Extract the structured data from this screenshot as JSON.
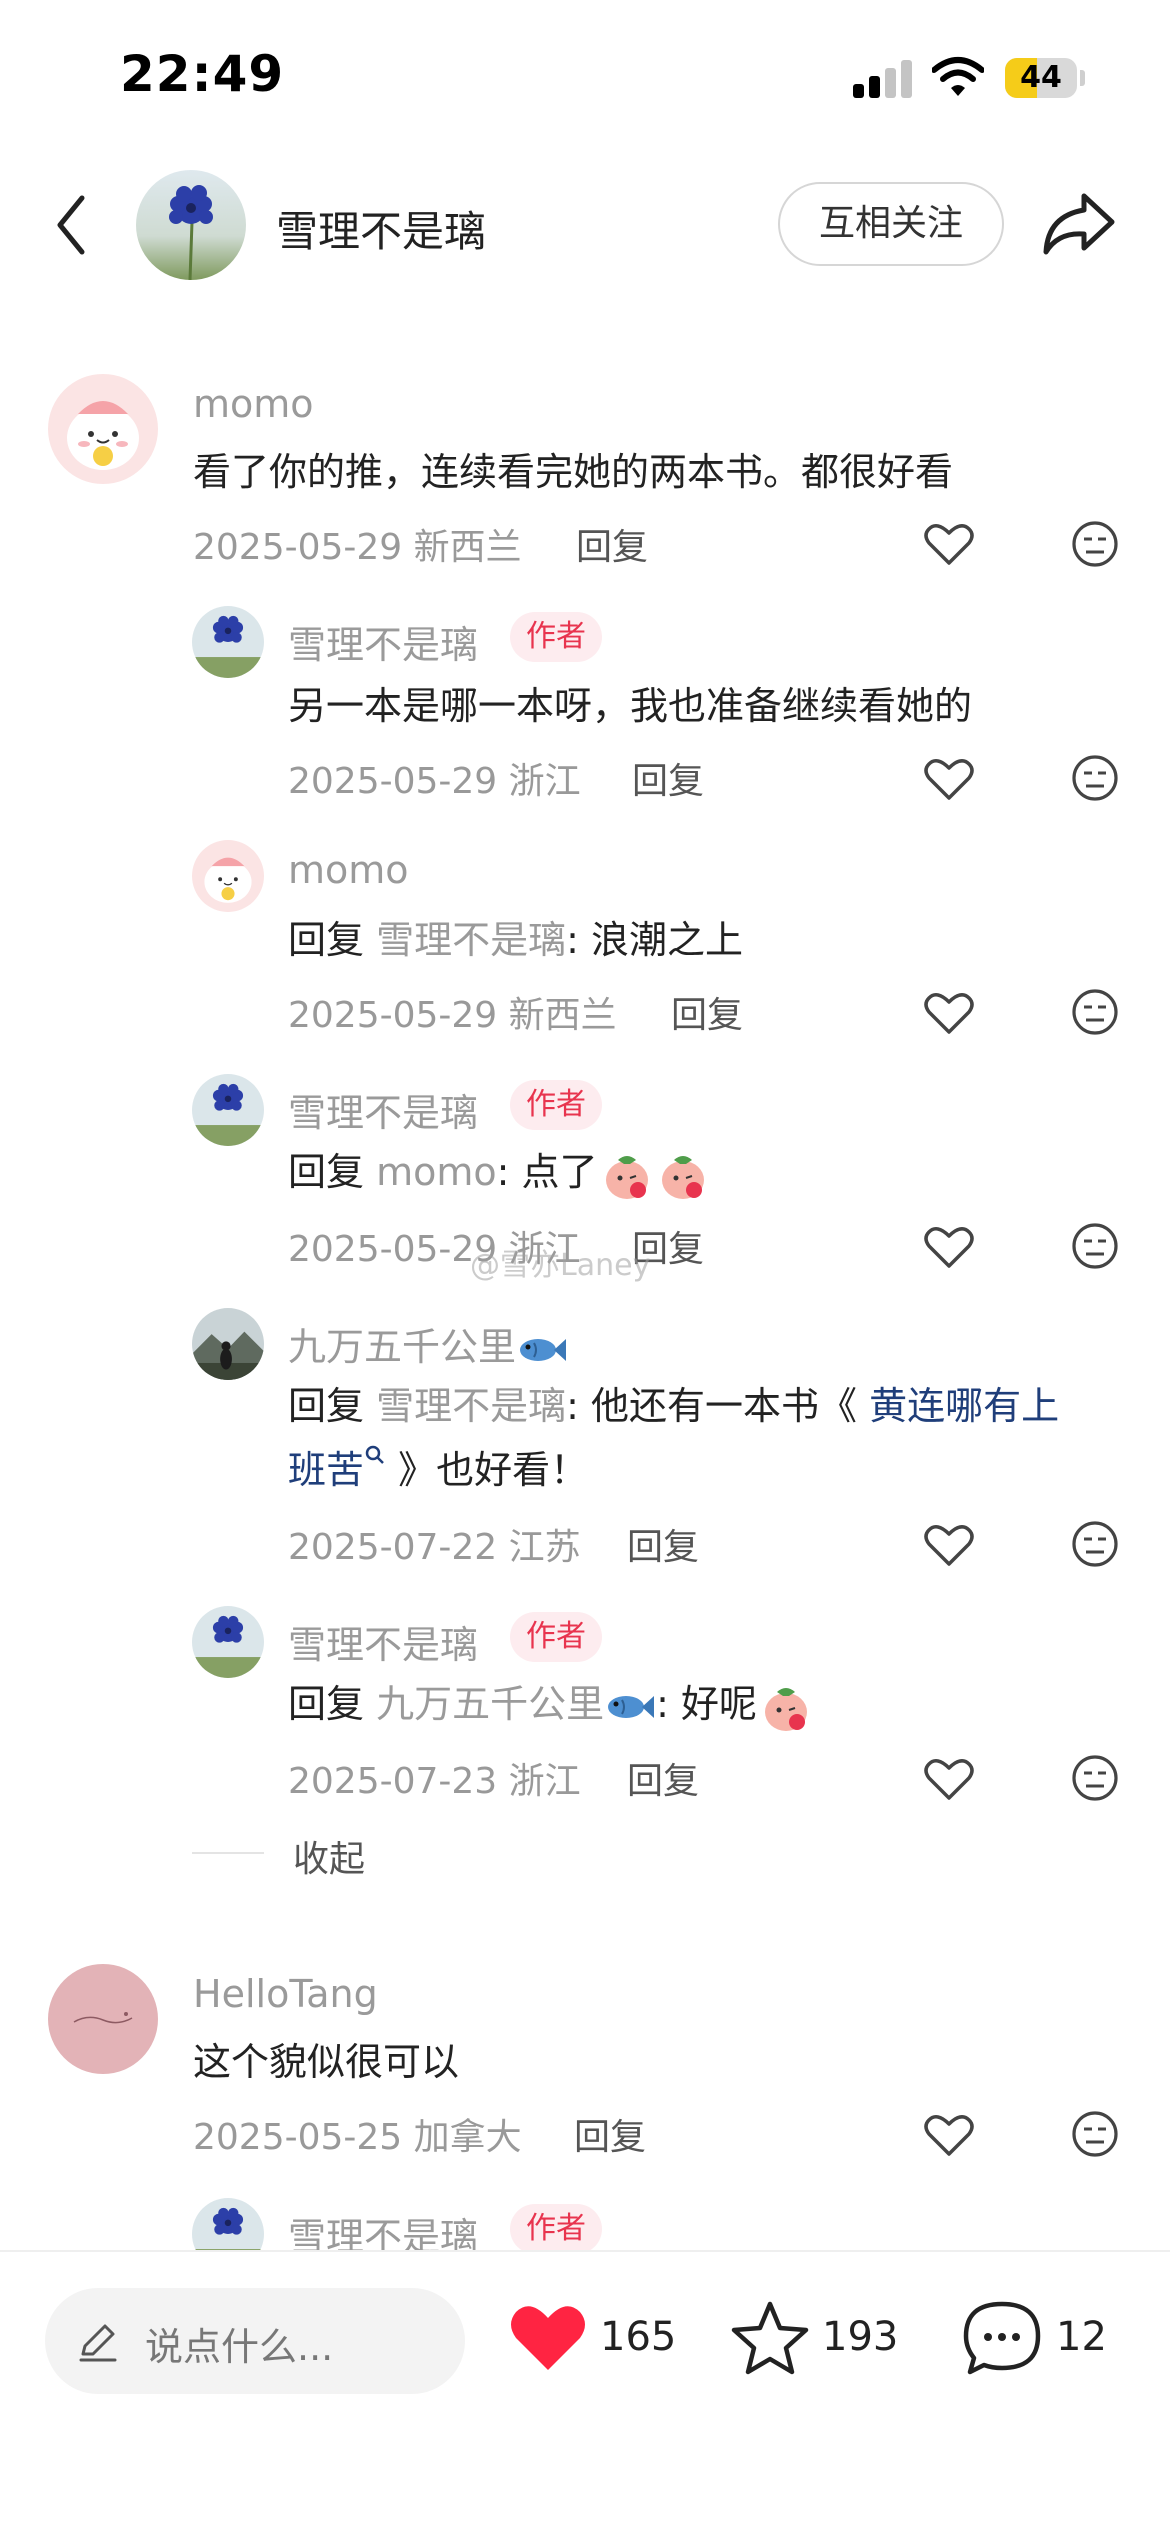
{
  "status_bar": {
    "time": "22:49",
    "battery_level": "44",
    "battery_fraction": 0.44
  },
  "header": {
    "author_name": "雪理不是璃",
    "follow_label": "互相关注"
  },
  "comments": [
    {
      "name": "momo",
      "text": "看了你的推，连续看完她的两本书。都很好看",
      "date": "2025-05-29",
      "location": "新西兰",
      "reply_label": "回复"
    },
    {
      "name": "雪理不是璃",
      "badge": "作者",
      "text": "另一本是哪一本呀，我也准备继续看她的",
      "date": "2025-05-29",
      "location": "浙江",
      "reply_label": "回复"
    },
    {
      "name": "momo",
      "reply_prefix": "回复",
      "mention": "雪理不是璃",
      "text": ": 浪潮之上",
      "date": "2025-05-29",
      "location": "新西兰",
      "reply_label": "回复"
    },
    {
      "name": "雪理不是璃",
      "badge": "作者",
      "reply_prefix": "回复",
      "mention": "momo",
      "text": ": 点了",
      "date": "2025-05-29",
      "location": "浙江",
      "reply_label": "回复"
    },
    {
      "name": "九万五千公里",
      "reply_prefix": "回复",
      "mention": "雪理不是璃",
      "text_a": ": 他还有一本书《",
      "link_a": "黄连哪有上",
      "link_b": "班苦",
      "text_b": "》也好看！",
      "date": "2025-07-22",
      "location": "江苏",
      "reply_label": "回复"
    },
    {
      "name": "雪理不是璃",
      "badge": "作者",
      "reply_prefix": "回复",
      "mention": "九万五千公里",
      "text": ": 好呢",
      "date": "2025-07-23",
      "location": "浙江",
      "reply_label": "回复"
    },
    {
      "name": "HelloTang",
      "text": "这个貌似很可以",
      "date": "2025-05-25",
      "location": "加拿大",
      "reply_label": "回复"
    },
    {
      "name": "雪理不是璃",
      "badge": "作者"
    }
  ],
  "collapse_label": "收起",
  "watermark": "@雪亦Laney",
  "bottom_bar": {
    "placeholder": "说点什么...",
    "likes": "165",
    "favorites": "193",
    "comments": "12"
  },
  "colors": {
    "accent_red": "#ff2442",
    "author_badge_text": "#e8344e",
    "author_badge_bg": "#fdecef",
    "link_blue": "#1f3e7a"
  }
}
